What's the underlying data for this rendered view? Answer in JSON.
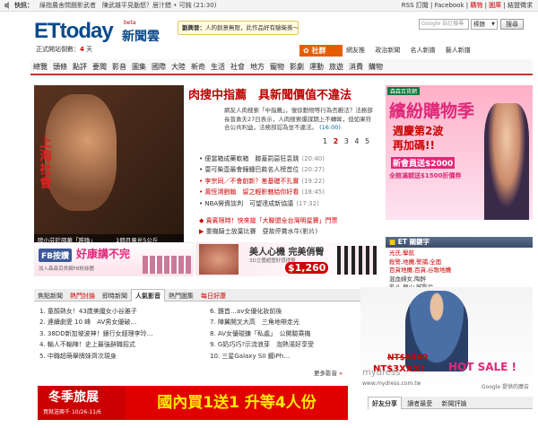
{
  "topbar": {
    "flash_label": "快訊：",
    "flash_text": "綠指農舍問題影武者　陳武雄平見動怒？居汁錯 • 可鈍 (21:30)",
    "links": [
      "RSS 訂閱",
      "Facebook",
      "購物",
      "圖庫",
      "結盟徵求"
    ],
    "separator": "|"
  },
  "header": {
    "logo_main": "ETtoday",
    "logo_beta": "beta",
    "logo_cn": "新聞雲",
    "countdown_prefix": "正式開站倒數：",
    "countdown_num": "4",
    "countdown_unit": "天",
    "quote_name": "劉興晉：",
    "quote_text": "人的創意無限，此作品好有驗衛羨～",
    "search_placeholder": "Google 自訂搜尋",
    "search_select": "標題",
    "search_button": "搜尋",
    "society_label": "社群",
    "society_links": [
      "網友推",
      "政治新聞",
      "名人新譜",
      "藝人新譜"
    ]
  },
  "nav": [
    "總覽",
    "頭條",
    "點評",
    "要聞",
    "影音",
    "圖集",
    "國際",
    "大陸",
    "新奇",
    "生活",
    "社會",
    "地方",
    "寵物",
    "影劇",
    "運動",
    "旅遊",
    "消費",
    "購物"
  ],
  "feature": {
    "photo_text_vertical": "上海社會",
    "photo_caption_left": "陸小芬於邵華「呼喚」",
    "photo_caption_right": "1個月風光5公斤",
    "headline": "肉搜中指薦　具新聞價值不違法",
    "summary": "網友人肉搜索「中指薦」，復徐動物等行為否觀法？法務部長曾勇夫27日表示，人肉搜索爆謀期上不轉眸，但如果符合公共利益，法務部認為並不違法。",
    "summary_time": "(16:00)",
    "pager": [
      "1",
      "2",
      "3",
      "4",
      "5"
    ],
    "pager_active": "2"
  },
  "news_list": [
    {
      "text": "便當箱成藥軟箱　膝蓋罰惡狂袁跳",
      "time": "(20:40)"
    },
    {
      "text": "耍可柴壺最會鐘鍾巴款名人榜首位",
      "time": "(20:27)"
    },
    {
      "text": "李宗同／不會創新？差基礎不扎實",
      "time": "(19:22)"
    },
    {
      "text": "黃恆鴻劉翰　留之輕影魅給你好看",
      "time": "(18:45)"
    },
    {
      "text": "NBA勞資談判　可望達成新協議",
      "time": "(17:32)"
    }
  ],
  "promo_links": [
    {
      "text": "貴賓限時！快來搶「大聯盟全台灣明星賽」門票"
    },
    {
      "text": "重機騎士放棄比賽　昼故停賞水牛(影片)"
    }
  ],
  "ads": {
    "right_store": "森森百貨網",
    "right_title": "繽紛購物季",
    "right_sub1": "週慶第2波",
    "right_sub2": "再加碼!!",
    "right_sub3": "新會員送$2000",
    "right_sub4": "全館滿額送$1500折價券",
    "fb_label": "FB按讚",
    "fb_text": "好康講不完",
    "fb_sub": "加入森森百貨網FB粉絲團",
    "beauty_title": "美人心機 完美俏臀",
    "beauty_sub": "3D立體超塑好感提臀",
    "beauty_price": "$1,260",
    "travel_title": "冬季旅展",
    "travel_sub": "買就送兩千",
    "travel_date": "10/26-11/6",
    "bogo": "國內買1送1 升等4人份",
    "mydress_brand": "mydress",
    "mydress_url": "www.mydress.com.tw",
    "mydress_sale": "HOT SALE !",
    "mydress_price": "NT$3XXX?",
    "mydress_price2": "NT$6480",
    "google_ads": "Google 提供的廣告"
  },
  "keywords": {
    "title": "ET 關鍵字",
    "items": [
      {
        "text": "光氏,擊航",
        "color": "#c00"
      },
      {
        "text": "殺警,地攤,警捕,全面",
        "color": "#c00"
      },
      {
        "text": "百貨地攤,百貨,谷歌地攤",
        "color": "#c00"
      },
      {
        "text": "混血婦女,陶醉",
        "color": "#333"
      },
      {
        "text": "乳斗,早山,膩影片",
        "color": "#333"
      }
    ]
  },
  "media_tabs": [
    "焦點新聞",
    "熱門討論",
    "即時新聞",
    "人氣影音",
    "熱門圖集",
    "每日好康"
  ],
  "media_tab_active": "人氣影音",
  "media_left": [
    "1. 童顏熟女！43歲美魔女小谷雅子",
    "2. 連續劇愛 10 峰　AV男女優破…",
    "3. 38DD新加坡波神！銀行女經理李玲…",
    "4. 輸人不輸陣！史上最強辭職招式",
    "5. 中職超萌舉牌妹齊次現身"
  ],
  "media_right": [
    "6. 雞首…av女優化妝前後",
    "7. 陣翼開叉大高　三角地帶走光",
    "8. AV女優碰鍊「私處」　公開驗乘機",
    "9. G奶巧巧?示流浪芽　泡熱湯好享受",
    "10. 三星Galaxy SII 鍍iPh…"
  ],
  "media_more": "更多影音",
  "share": {
    "tabs": [
      "好友分享",
      "讀者最愛",
      "新聞評論"
    ]
  }
}
